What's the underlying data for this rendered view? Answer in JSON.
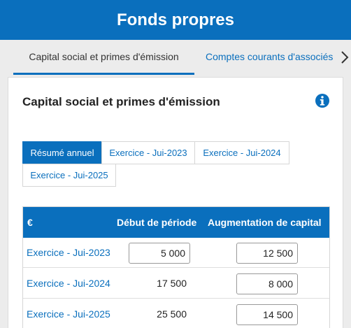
{
  "header": {
    "title": "Fonds propres"
  },
  "tabs": [
    {
      "label": "Capital social et primes d'émission",
      "active": true
    },
    {
      "label": "Comptes courants d'associés",
      "active": false
    }
  ],
  "panel": {
    "title": "Capital social et primes d'émission",
    "segments": [
      {
        "label": "Résumé annuel",
        "active": true
      },
      {
        "label": "Exercice - Jui-2023",
        "active": false
      },
      {
        "label": "Exercice - Jui-2024",
        "active": false
      },
      {
        "label": "Exercice - Jui-2025",
        "active": false
      }
    ],
    "table": {
      "headers": [
        "€",
        "Début de période",
        "Augmentation de capital"
      ],
      "rows": [
        {
          "label": "Exercice - Jui-2023",
          "debut": "5 000",
          "augmentation": "12 500"
        },
        {
          "label": "Exercice - Jui-2024",
          "debut": "17 500",
          "augmentation": "8 000"
        },
        {
          "label": "Exercice - Jui-2025",
          "debut": "25 500",
          "augmentation": "14 500"
        }
      ]
    }
  },
  "colors": {
    "primary": "#0a6fbd",
    "background": "#ececec"
  },
  "icons": {
    "info": "info-circle-icon",
    "tab_scroll": "chevron-right-icon"
  }
}
